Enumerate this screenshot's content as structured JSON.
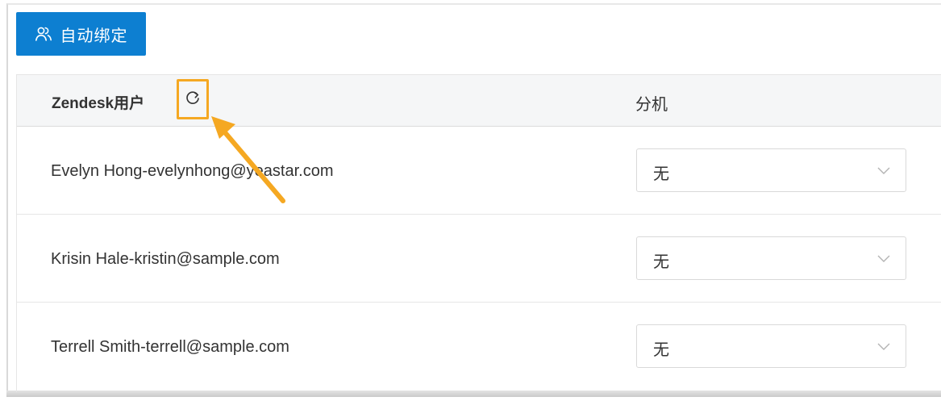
{
  "toolbar": {
    "auto_bind_label": "自动绑定",
    "auto_bind_icon": "users-icon",
    "button_color": "#0d7fd1"
  },
  "table": {
    "columns": {
      "user": "Zendesk用户",
      "extension": "分机"
    },
    "refresh_icon": "refresh-icon",
    "rows": [
      {
        "user": "Evelyn Hong-evelynhong@yeastar.com",
        "extension": "无"
      },
      {
        "user": "Krisin Hale-kristin@sample.com",
        "extension": "无"
      },
      {
        "user": "Terrell Smith-terrell@sample.com",
        "extension": "无"
      }
    ]
  },
  "annotation": {
    "highlight_color": "#f5a822"
  }
}
